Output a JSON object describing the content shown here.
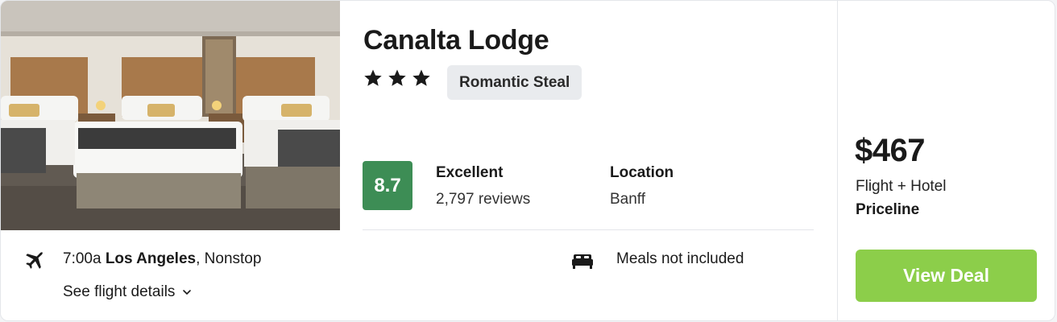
{
  "hotel": {
    "name": "Canalta Lodge",
    "star_count": 3,
    "tag": "Romantic Steal",
    "photo_icon": "hotel-room-photo"
  },
  "rating": {
    "score": "8.7",
    "label": "Excellent",
    "reviews": "2,797 reviews",
    "score_color": "#3d8d55"
  },
  "location": {
    "title": "Location",
    "value": "Banff"
  },
  "flight": {
    "time": "7:00a",
    "city": "Los Angeles",
    "stops": ", Nonstop",
    "details_link": "See flight details",
    "icon": "airplane-icon"
  },
  "amenities": {
    "meals": "Meals not included",
    "icon": "bed-icon"
  },
  "deal": {
    "price": "$467",
    "type": "Flight + Hotel",
    "provider": "Priceline",
    "button_label": "View Deal",
    "button_color": "#8cce4a"
  }
}
